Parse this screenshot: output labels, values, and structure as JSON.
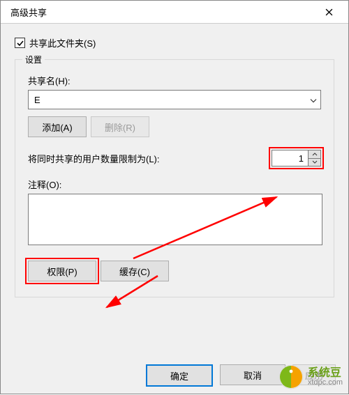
{
  "window": {
    "title": "高级共享"
  },
  "checkbox": {
    "label": "共享此文件夹(S)",
    "checked": true
  },
  "group": {
    "legend": "设置",
    "share_name_label": "共享名(H):",
    "share_name_value": "E",
    "add_button": "添加(A)",
    "remove_button": "删除(R)",
    "limit_label": "将同时共享的用户数量限制为(L):",
    "limit_value": "1",
    "comment_label": "注释(O):",
    "permissions_button": "权限(P)",
    "cache_button": "缓存(C)"
  },
  "footer": {
    "ok": "确定",
    "cancel": "取消",
    "apply": "应用"
  },
  "watermark": {
    "name": "系统豆",
    "url": "xtdpc.com"
  }
}
